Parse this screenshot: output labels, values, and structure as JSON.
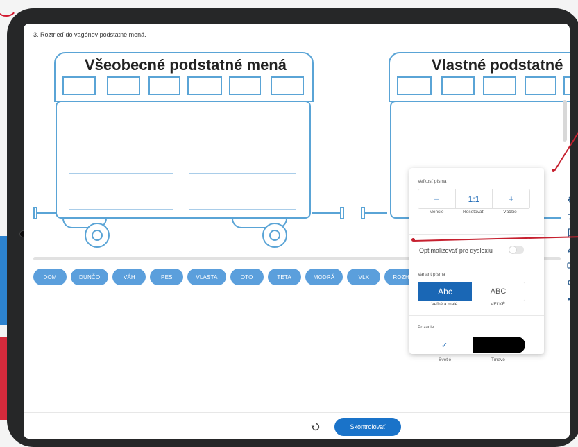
{
  "task": {
    "title": "3. Roztrieď do vagónov podstatné mená."
  },
  "wagons": [
    {
      "title": "Všeobecné podstatné mená"
    },
    {
      "title": "Vlastné podstatné"
    }
  ],
  "chips": [
    "DOM",
    "DUNČO",
    "VÁH",
    "PES",
    "VLASTA",
    "OTO",
    "TETA",
    "MODRÁ",
    "VLK",
    "ROZHLAS"
  ],
  "bottom": {
    "check_label": "Skontrolovať"
  },
  "settings": {
    "font_size_label": "Veľkosť písma",
    "decrease_symbol": "−",
    "reset_symbol": "1:1",
    "increase_symbol": "+",
    "decrease_label": "Menšie",
    "reset_label": "Resetovať",
    "increase_label": "Väčšie",
    "dyslexia_label": "Optimalizovať pre dyslexiu",
    "dyslexia_enabled": false,
    "font_variant_label": "Variant písma",
    "font_option_1": "Abc",
    "font_option_2": "ABC",
    "font_option_1_caption": "Veľké a malé",
    "font_option_2_caption": "VEĽKÉ",
    "background_label": "Pozadie",
    "bg_light_check": "✓",
    "bg_light_label": "Svetlé",
    "bg_dark_label": "Tmavé"
  },
  "toolbar": {
    "icons": [
      "gear-icon",
      "accessibility-icon",
      "bookmark-icon",
      "pencil-icon",
      "screen-icon",
      "refresh-icon",
      "share-icon"
    ]
  },
  "colors": {
    "accent": "#1a67b5",
    "chip": "#5b9fdc",
    "wagon_outline": "#5aa4d6",
    "annotation": "#c6202f"
  }
}
